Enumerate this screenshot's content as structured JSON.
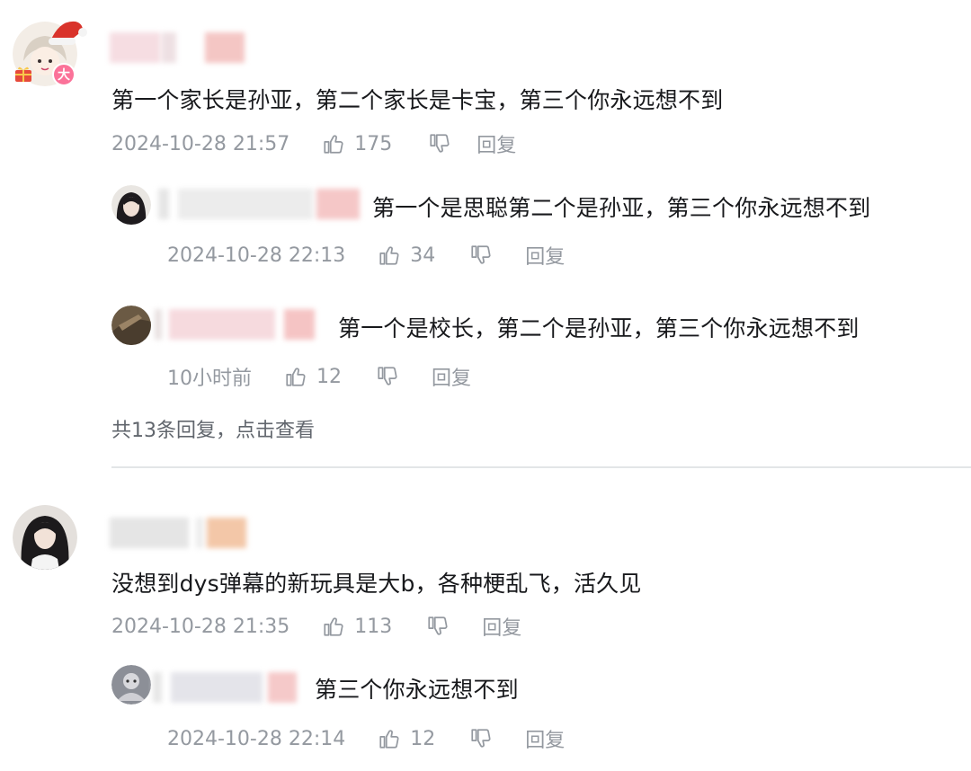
{
  "comments": [
    {
      "text": "第一个家长是孙亚，第二个家长是卡宝，第三个你永远想不到",
      "time": "2024-10-28 21:57",
      "likes": "175",
      "reply_label": "回复",
      "avatar_badge": "大",
      "replies": [
        {
          "text": "第一个是思聪第二个是孙亚，第三个你永远想不到",
          "time": "2024-10-28 22:13",
          "likes": "34",
          "reply_label": "回复"
        },
        {
          "text": "第一个是校长，第二个是孙亚，第三个你永远想不到",
          "time": "10小时前",
          "likes": "12",
          "reply_label": "回复"
        }
      ],
      "more_replies": "共13条回复，点击查看"
    },
    {
      "text": "没想到dys弹幕的新玩具是大b，各种梗乱飞，活久见",
      "time": "2024-10-28 21:35",
      "likes": "113",
      "reply_label": "回复",
      "replies": [
        {
          "text": "第三个你永远想不到",
          "time": "2024-10-28 22:14",
          "likes": "12",
          "reply_label": "回复"
        }
      ]
    }
  ],
  "colors": {
    "text": "#18191c",
    "meta": "#9499a0",
    "divider": "#e3e5e7"
  }
}
